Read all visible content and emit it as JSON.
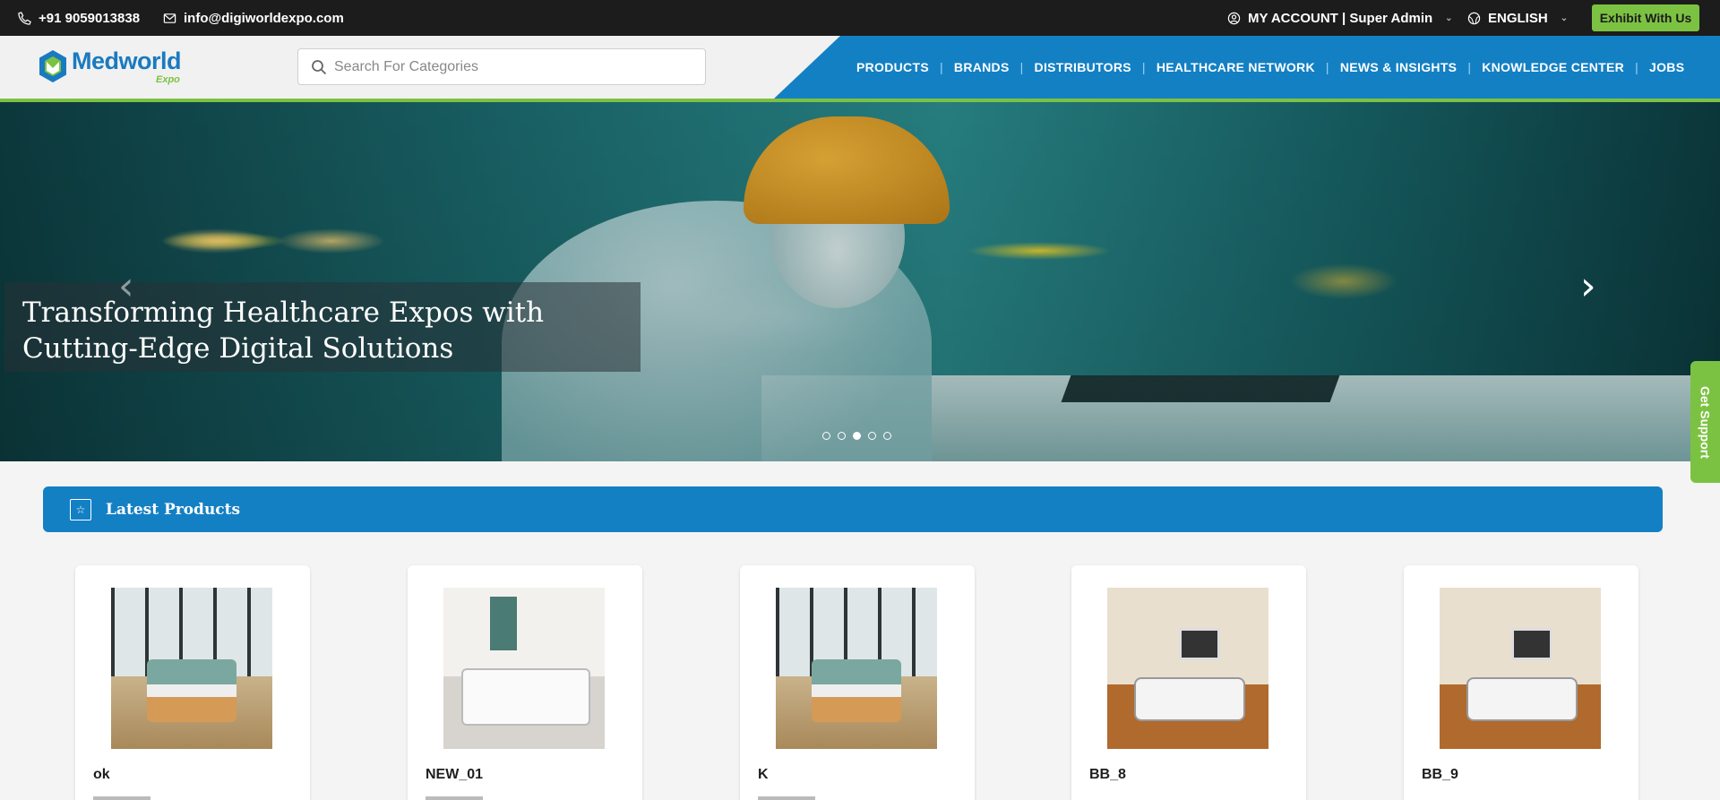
{
  "topbar": {
    "phone": "+91 9059013838",
    "email": "info@digiworldexpo.com",
    "account": "MY ACCOUNT | Super Admin",
    "language": "ENGLISH",
    "exhibit": "Exhibit With Us"
  },
  "header": {
    "logo_main": "Medworld",
    "logo_sub": "Expo",
    "search_placeholder": "Search For Categories"
  },
  "nav": [
    "PRODUCTS",
    "BRANDS",
    "DISTRIBUTORS",
    "HEALTHCARE NETWORK",
    "NEWS & INSIGHTS",
    "KNOWLEDGE CENTER",
    "JOBS"
  ],
  "hero": {
    "caption_line1": "Transforming Healthcare Expos with",
    "caption_line2": "Cutting-Edge Digital Solutions",
    "slide_count": 5,
    "active_slide": 3
  },
  "support": {
    "label": "Get Support"
  },
  "latest": {
    "title": "Latest Products",
    "products": [
      {
        "name": "ok",
        "image": "hospital-room-window-bed"
      },
      {
        "name": "NEW_01",
        "image": "white-hospital-bed"
      },
      {
        "name": "K",
        "image": "hospital-room-window-bed"
      },
      {
        "name": "BB_8",
        "image": "icu-bed-wood-floor"
      },
      {
        "name": "BB_9",
        "image": "icu-bed-wood-floor"
      }
    ]
  },
  "colors": {
    "brand_blue": "#1480c4",
    "brand_green": "#7cc242",
    "topbar_bg": "#1c1c1c"
  }
}
